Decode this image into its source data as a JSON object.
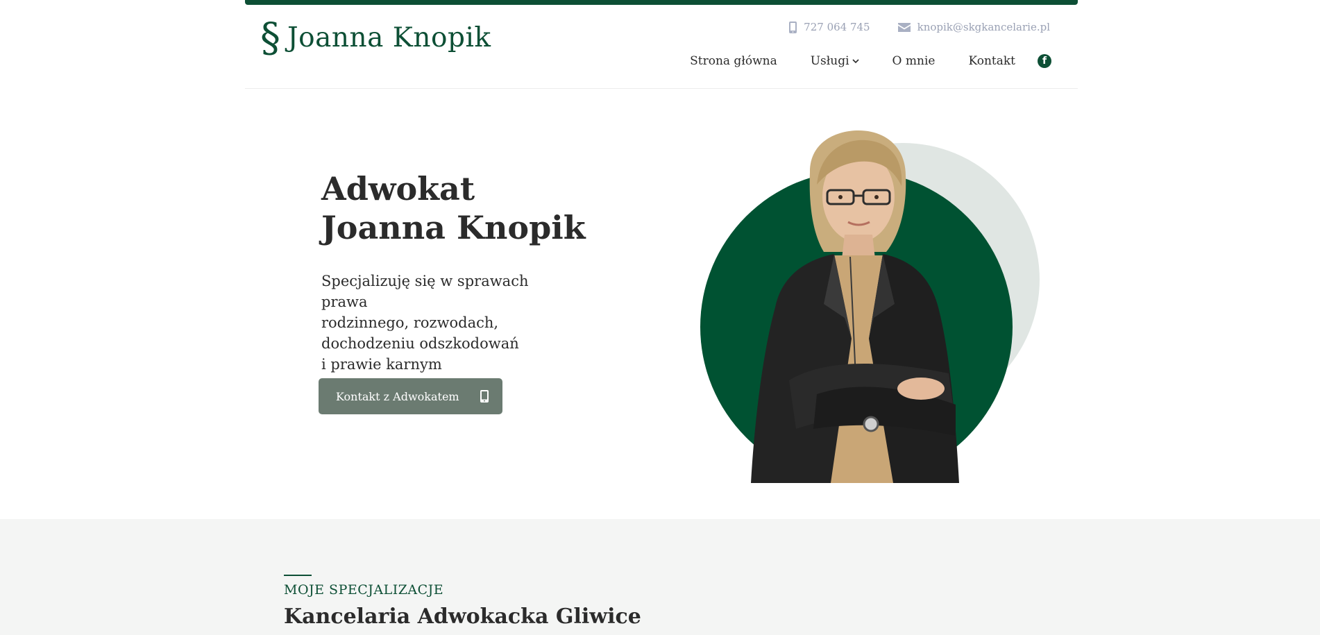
{
  "brand": {
    "mark": "§",
    "name": "Joanna Knopik",
    "color": "#0d4f35"
  },
  "contact": {
    "phone": "727 064 745",
    "email": "knopik@skgkancelarie.pl"
  },
  "nav": {
    "items": [
      {
        "label": "Strona główna"
      },
      {
        "label": "Usługi"
      },
      {
        "label": "O mnie"
      },
      {
        "label": "Kontakt"
      }
    ],
    "social_icon": "facebook-icon"
  },
  "hero": {
    "title_line1": "Adwokat",
    "title_line2": "Joanna Knopik",
    "subtitle_line1": "Specjalizuję się w sprawach prawa",
    "subtitle_line2": "rodzinnego, rozwodach,",
    "subtitle_line3": "dochodzeniu odszkodowań",
    "subtitle_line4": "i prawie karnym",
    "cta_label": "Kontakt z Adwokatem"
  },
  "section": {
    "eyebrow": "MOJE SPECJALIZACJE",
    "title": "Kancelaria Adwokacka Gliwice"
  }
}
